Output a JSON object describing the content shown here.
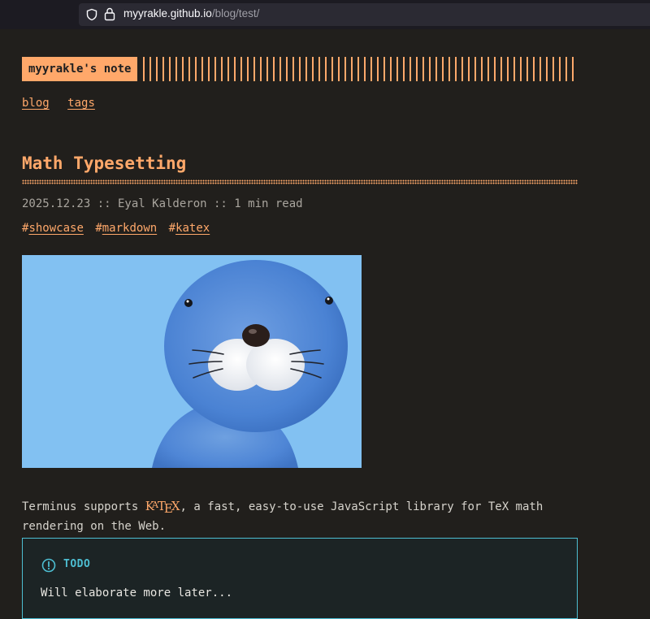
{
  "browser": {
    "url_host": "myyrakle.github.io",
    "url_path": "/blog/test/"
  },
  "site": {
    "logo": "myyrakle's note",
    "nav": [
      {
        "label": "blog"
      },
      {
        "label": "tags"
      }
    ]
  },
  "post": {
    "title": "Math Typesetting",
    "meta": "2025.12.23 :: Eyal Kalderon :: 1 min read",
    "tags": [
      {
        "hash": "#",
        "label": "showcase"
      },
      {
        "hash": "#",
        "label": "markdown"
      },
      {
        "hash": "#",
        "label": "katex"
      }
    ],
    "intro_before": "Terminus supports ",
    "intro_after": ", a fast, easy-to-use JavaScript library for TeX math rendering on the Web.",
    "katex_logo": "KaTeX"
  },
  "callout": {
    "type_label": "TODO",
    "body": "Will elaborate more later..."
  },
  "colors": {
    "accent": "#ffa86a",
    "background": "#211f1c",
    "callout_border": "#4dbed2"
  }
}
